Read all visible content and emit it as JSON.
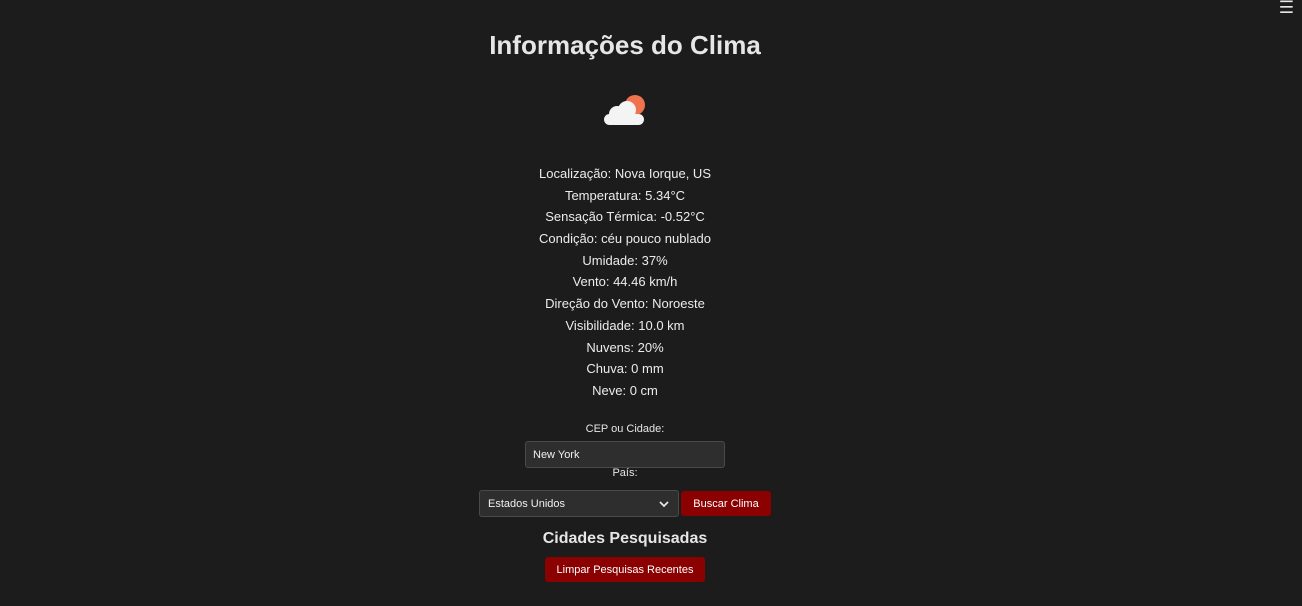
{
  "header": {
    "title": "Informações do Clima",
    "menu_icon": "☰"
  },
  "weather": {
    "icon": "cloud-sun-icon",
    "details": [
      "Localização: Nova Iorque, US",
      "Temperatura: 5.34°C",
      "Sensação Térmica: -0.52°C",
      "Condição: céu pouco nublado",
      "Umidade: 37%",
      "Vento: 44.46 km/h",
      "Direção do Vento: Noroeste",
      "Visibilidade: 10.0 km",
      "Nuvens: 20%",
      "Chuva: 0 mm",
      "Neve: 0 cm"
    ]
  },
  "form": {
    "city_label": "CEP ou Cidade:",
    "city_value": "New York",
    "country_label": "País:",
    "country_selected": "Estados Unidos",
    "search_button": "Buscar Clima"
  },
  "history": {
    "title": "Cidades Pesquisadas",
    "clear_button": "Limpar Pesquisas Recentes"
  },
  "colors": {
    "background": "#1c1c1c",
    "accent": "#8b0000",
    "sun": "#f0734f"
  }
}
